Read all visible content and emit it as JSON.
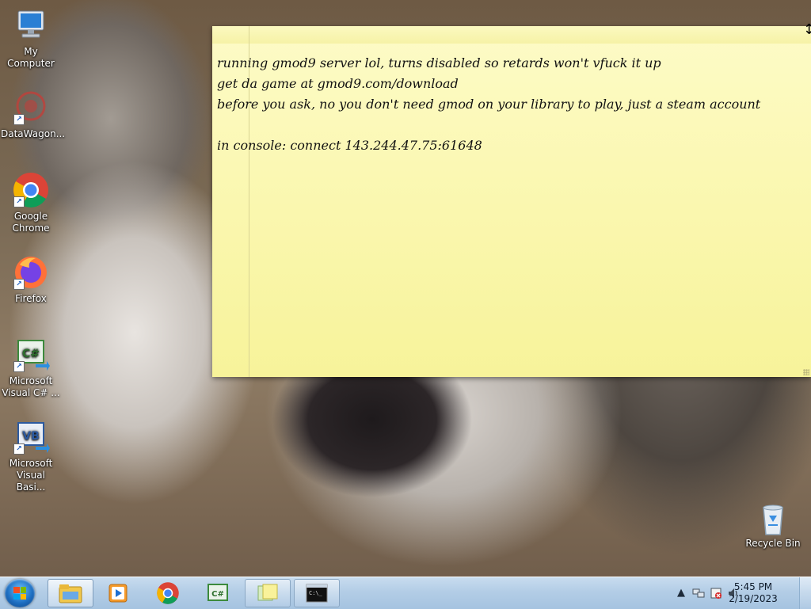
{
  "desktop": {
    "icons": [
      {
        "label": "My Computer",
        "icon": "my-computer-icon"
      },
      {
        "label": "DataWagon...",
        "icon": "datawagon-icon"
      },
      {
        "label": "Google Chrome",
        "icon": "chrome-icon"
      },
      {
        "label": "Firefox",
        "icon": "firefox-icon"
      },
      {
        "label": "Microsoft Visual C# ...",
        "icon": "visual-csharp-icon"
      },
      {
        "label": "Microsoft Visual Basi...",
        "icon": "visual-basic-icon"
      }
    ],
    "recycle_bin": {
      "label": "Recycle Bin",
      "icon": "recycle-bin-icon"
    }
  },
  "sticky_note": {
    "lines": [
      "running gmod9 server lol, turns disabled so retards won't vfuck it up",
      "get da game at gmod9.com/download",
      "before you ask, no you don't need gmod on your library to play, just a steam account",
      "",
      "in console: connect 143.244.47.75:61648"
    ],
    "color": "#fbf8b4"
  },
  "taskbar": {
    "start": {
      "icon": "windows-start-orb-icon"
    },
    "buttons": [
      {
        "icon": "windows-explorer-icon"
      },
      {
        "icon": "media-player-icon"
      },
      {
        "icon": "chrome-icon"
      },
      {
        "icon": "visual-csharp-icon"
      },
      {
        "icon": "sticky-notes-icon"
      },
      {
        "icon": "command-prompt-icon"
      }
    ],
    "tray": {
      "time": "5:45 PM",
      "date": "2/19/2023",
      "icons": [
        "show-hidden-icons-chevron",
        "network-icon",
        "action-center-icon",
        "volume-icon"
      ]
    }
  }
}
